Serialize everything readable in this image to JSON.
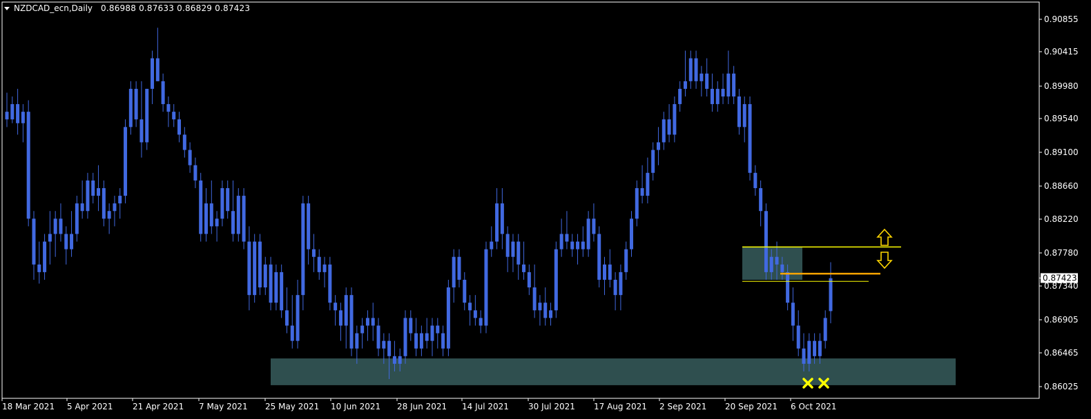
{
  "header": {
    "symbol": "NZDCAD_ecn,Daily",
    "ohlc": "0.86988 0.87633 0.86829 0.87423"
  },
  "colors": {
    "background": "#000000",
    "candle": "#4169e1",
    "zone": "#2f4f4f",
    "support_line": "#ffff00",
    "resistance_line": "#ffa500",
    "arrow": "#ffd700",
    "marker": "#ffff00",
    "axis_text": "#ffffff"
  },
  "chart_data": {
    "type": "candlestick",
    "title": "NZDCAD_ecn,Daily",
    "ylim": [
      0.8592,
      0.91
    ],
    "y_ticks": [
      "0.90855",
      "0.90415",
      "0.89980",
      "0.89540",
      "0.89100",
      "0.88660",
      "0.88220",
      "0.87780",
      "0.87340",
      "0.86905",
      "0.86465",
      "0.86025"
    ],
    "x_ticks": [
      "18 Mar 2021",
      "5 Apr 2021",
      "21 Apr 2021",
      "7 May 2021",
      "25 May 2021",
      "10 Jun 2021",
      "28 Jun 2021",
      "14 Jul 2021",
      "30 Jul 2021",
      "17 Aug 2021",
      "2 Sep 2021",
      "20 Sep 2021",
      "6 Oct 2021"
    ],
    "current_price": "0.87423",
    "candles": [
      [
        0.896,
        0.8985,
        0.894,
        0.895
      ],
      [
        0.895,
        0.898,
        0.8945,
        0.897
      ],
      [
        0.897,
        0.899,
        0.893,
        0.8945
      ],
      [
        0.8945,
        0.897,
        0.892,
        0.896
      ],
      [
        0.896,
        0.8975,
        0.881,
        0.882
      ],
      [
        0.882,
        0.883,
        0.874,
        0.876
      ],
      [
        0.876,
        0.879,
        0.8735,
        0.875
      ],
      [
        0.875,
        0.88,
        0.874,
        0.879
      ],
      [
        0.879,
        0.883,
        0.876,
        0.88
      ],
      [
        0.88,
        0.883,
        0.877,
        0.882
      ],
      [
        0.882,
        0.884,
        0.879,
        0.88
      ],
      [
        0.88,
        0.881,
        0.876,
        0.878
      ],
      [
        0.878,
        0.883,
        0.877,
        0.88
      ],
      [
        0.88,
        0.885,
        0.879,
        0.884
      ],
      [
        0.884,
        0.887,
        0.882,
        0.883
      ],
      [
        0.883,
        0.888,
        0.882,
        0.887
      ],
      [
        0.887,
        0.888,
        0.884,
        0.885
      ],
      [
        0.885,
        0.889,
        0.883,
        0.886
      ],
      [
        0.886,
        0.887,
        0.881,
        0.882
      ],
      [
        0.882,
        0.884,
        0.88,
        0.883
      ],
      [
        0.883,
        0.885,
        0.881,
        0.884
      ],
      [
        0.884,
        0.886,
        0.882,
        0.885
      ],
      [
        0.885,
        0.895,
        0.884,
        0.894
      ],
      [
        0.894,
        0.9,
        0.893,
        0.899
      ],
      [
        0.899,
        0.9,
        0.894,
        0.895
      ],
      [
        0.895,
        0.9,
        0.89,
        0.892
      ],
      [
        0.892,
        0.899,
        0.891,
        0.899
      ],
      [
        0.899,
        0.904,
        0.897,
        0.903
      ],
      [
        0.903,
        0.907,
        0.9,
        0.9
      ],
      [
        0.9,
        0.901,
        0.896,
        0.897
      ],
      [
        0.897,
        0.898,
        0.894,
        0.896
      ],
      [
        0.896,
        0.897,
        0.894,
        0.895
      ],
      [
        0.895,
        0.896,
        0.892,
        0.893
      ],
      [
        0.893,
        0.894,
        0.89,
        0.891
      ],
      [
        0.891,
        0.892,
        0.888,
        0.889
      ],
      [
        0.889,
        0.89,
        0.886,
        0.887
      ],
      [
        0.887,
        0.888,
        0.879,
        0.88
      ],
      [
        0.88,
        0.886,
        0.879,
        0.884
      ],
      [
        0.884,
        0.887,
        0.88,
        0.881
      ],
      [
        0.881,
        0.883,
        0.879,
        0.882
      ],
      [
        0.882,
        0.887,
        0.881,
        0.886
      ],
      [
        0.886,
        0.887,
        0.882,
        0.883
      ],
      [
        0.883,
        0.887,
        0.879,
        0.88
      ],
      [
        0.88,
        0.886,
        0.879,
        0.885
      ],
      [
        0.885,
        0.886,
        0.878,
        0.879
      ],
      [
        0.879,
        0.881,
        0.87,
        0.872
      ],
      [
        0.872,
        0.88,
        0.871,
        0.879
      ],
      [
        0.879,
        0.88,
        0.872,
        0.873
      ],
      [
        0.873,
        0.877,
        0.872,
        0.876
      ],
      [
        0.876,
        0.877,
        0.87,
        0.871
      ],
      [
        0.871,
        0.876,
        0.87,
        0.875
      ],
      [
        0.875,
        0.876,
        0.869,
        0.87
      ],
      [
        0.87,
        0.873,
        0.867,
        0.868
      ],
      [
        0.868,
        0.872,
        0.865,
        0.866
      ],
      [
        0.866,
        0.874,
        0.865,
        0.872
      ],
      [
        0.872,
        0.885,
        0.87,
        0.884
      ],
      [
        0.884,
        0.885,
        0.876,
        0.878
      ],
      [
        0.878,
        0.88,
        0.875,
        0.877
      ],
      [
        0.877,
        0.878,
        0.874,
        0.875
      ],
      [
        0.875,
        0.877,
        0.873,
        0.876
      ],
      [
        0.876,
        0.877,
        0.87,
        0.871
      ],
      [
        0.871,
        0.872,
        0.868,
        0.87
      ],
      [
        0.87,
        0.871,
        0.866,
        0.868
      ],
      [
        0.868,
        0.873,
        0.865,
        0.872
      ],
      [
        0.872,
        0.873,
        0.864,
        0.865
      ],
      [
        0.865,
        0.868,
        0.863,
        0.867
      ],
      [
        0.867,
        0.869,
        0.865,
        0.868
      ],
      [
        0.868,
        0.87,
        0.866,
        0.869
      ],
      [
        0.869,
        0.871,
        0.866,
        0.868
      ],
      [
        0.868,
        0.869,
        0.864,
        0.865
      ],
      [
        0.865,
        0.867,
        0.863,
        0.866
      ],
      [
        0.866,
        0.867,
        0.861,
        0.864
      ],
      [
        0.864,
        0.866,
        0.862,
        0.863
      ],
      [
        0.863,
        0.865,
        0.862,
        0.864
      ],
      [
        0.864,
        0.87,
        0.863,
        0.869
      ],
      [
        0.869,
        0.87,
        0.866,
        0.867
      ],
      [
        0.867,
        0.869,
        0.864,
        0.865
      ],
      [
        0.865,
        0.868,
        0.864,
        0.867
      ],
      [
        0.867,
        0.869,
        0.865,
        0.866
      ],
      [
        0.866,
        0.869,
        0.864,
        0.868
      ],
      [
        0.868,
        0.869,
        0.865,
        0.867
      ],
      [
        0.867,
        0.868,
        0.864,
        0.865
      ],
      [
        0.865,
        0.874,
        0.864,
        0.873
      ],
      [
        0.873,
        0.878,
        0.871,
        0.877
      ],
      [
        0.877,
        0.878,
        0.873,
        0.874
      ],
      [
        0.874,
        0.875,
        0.87,
        0.871
      ],
      [
        0.871,
        0.872,
        0.868,
        0.87
      ],
      [
        0.87,
        0.872,
        0.868,
        0.869
      ],
      [
        0.869,
        0.87,
        0.867,
        0.868
      ],
      [
        0.868,
        0.879,
        0.867,
        0.878
      ],
      [
        0.878,
        0.881,
        0.877,
        0.879
      ],
      [
        0.879,
        0.886,
        0.878,
        0.884
      ],
      [
        0.884,
        0.886,
        0.878,
        0.88
      ],
      [
        0.88,
        0.881,
        0.875,
        0.877
      ],
      [
        0.877,
        0.88,
        0.875,
        0.879
      ],
      [
        0.879,
        0.88,
        0.874,
        0.876
      ],
      [
        0.876,
        0.879,
        0.874,
        0.875
      ],
      [
        0.875,
        0.876,
        0.872,
        0.873
      ],
      [
        0.873,
        0.876,
        0.869,
        0.87
      ],
      [
        0.87,
        0.872,
        0.868,
        0.871
      ],
      [
        0.871,
        0.873,
        0.868,
        0.869
      ],
      [
        0.869,
        0.871,
        0.868,
        0.87
      ],
      [
        0.87,
        0.879,
        0.869,
        0.878
      ],
      [
        0.878,
        0.882,
        0.877,
        0.88
      ],
      [
        0.88,
        0.883,
        0.878,
        0.879
      ],
      [
        0.879,
        0.88,
        0.877,
        0.878
      ],
      [
        0.878,
        0.88,
        0.876,
        0.879
      ],
      [
        0.879,
        0.881,
        0.877,
        0.878
      ],
      [
        0.878,
        0.883,
        0.877,
        0.882
      ],
      [
        0.882,
        0.884,
        0.879,
        0.88
      ],
      [
        0.88,
        0.881,
        0.873,
        0.874
      ],
      [
        0.874,
        0.877,
        0.872,
        0.876
      ],
      [
        0.876,
        0.878,
        0.873,
        0.874
      ],
      [
        0.874,
        0.875,
        0.87,
        0.872
      ],
      [
        0.872,
        0.876,
        0.87,
        0.875
      ],
      [
        0.875,
        0.879,
        0.874,
        0.878
      ],
      [
        0.878,
        0.883,
        0.877,
        0.882
      ],
      [
        0.882,
        0.887,
        0.881,
        0.886
      ],
      [
        0.886,
        0.889,
        0.884,
        0.885
      ],
      [
        0.885,
        0.89,
        0.884,
        0.888
      ],
      [
        0.888,
        0.892,
        0.887,
        0.891
      ],
      [
        0.891,
        0.894,
        0.889,
        0.892
      ],
      [
        0.892,
        0.896,
        0.891,
        0.895
      ],
      [
        0.895,
        0.897,
        0.892,
        0.893
      ],
      [
        0.893,
        0.898,
        0.892,
        0.897
      ],
      [
        0.897,
        0.9,
        0.896,
        0.899
      ],
      [
        0.899,
        0.904,
        0.898,
        0.9
      ],
      [
        0.9,
        0.904,
        0.899,
        0.903
      ],
      [
        0.903,
        0.904,
        0.899,
        0.9
      ],
      [
        0.9,
        0.902,
        0.898,
        0.901
      ],
      [
        0.901,
        0.903,
        0.898,
        0.899
      ],
      [
        0.899,
        0.901,
        0.896,
        0.897
      ],
      [
        0.897,
        0.9,
        0.896,
        0.899
      ],
      [
        0.899,
        0.901,
        0.897,
        0.898
      ],
      [
        0.898,
        0.904,
        0.897,
        0.901
      ],
      [
        0.901,
        0.902,
        0.897,
        0.898
      ],
      [
        0.898,
        0.899,
        0.893,
        0.894
      ],
      [
        0.894,
        0.898,
        0.892,
        0.897
      ],
      [
        0.897,
        0.898,
        0.887,
        0.888
      ],
      [
        0.888,
        0.889,
        0.885,
        0.886
      ],
      [
        0.886,
        0.887,
        0.881,
        0.883
      ],
      [
        0.883,
        0.884,
        0.874,
        0.875
      ],
      [
        0.875,
        0.878,
        0.874,
        0.877
      ],
      [
        0.877,
        0.879,
        0.874,
        0.876
      ],
      [
        0.876,
        0.877,
        0.874,
        0.875
      ],
      [
        0.875,
        0.876,
        0.87,
        0.871
      ],
      [
        0.871,
        0.873,
        0.866,
        0.868
      ],
      [
        0.868,
        0.87,
        0.864,
        0.865
      ],
      [
        0.865,
        0.867,
        0.862,
        0.863
      ],
      [
        0.863,
        0.867,
        0.862,
        0.866
      ],
      [
        0.866,
        0.867,
        0.863,
        0.864
      ],
      [
        0.864,
        0.867,
        0.863,
        0.866
      ],
      [
        0.866,
        0.87,
        0.865,
        0.869
      ],
      [
        0.8699,
        0.8763,
        0.8683,
        0.8742
      ]
    ],
    "annotations": [
      {
        "type": "zone",
        "label": "support zone",
        "y": [
          0.8602,
          0.8637
        ]
      },
      {
        "type": "zone",
        "label": "resistance zone",
        "y": [
          0.874,
          0.8783
        ]
      },
      {
        "type": "hline",
        "label": "resistance line",
        "y": 0.8783
      },
      {
        "type": "hline",
        "label": "support line",
        "y": 0.8738
      },
      {
        "type": "hline",
        "label": "orange level",
        "y": 0.8748
      },
      {
        "type": "arrow",
        "direction": "up"
      },
      {
        "type": "arrow",
        "direction": "down"
      },
      {
        "type": "marker",
        "shape": "x",
        "count": 2
      }
    ]
  }
}
